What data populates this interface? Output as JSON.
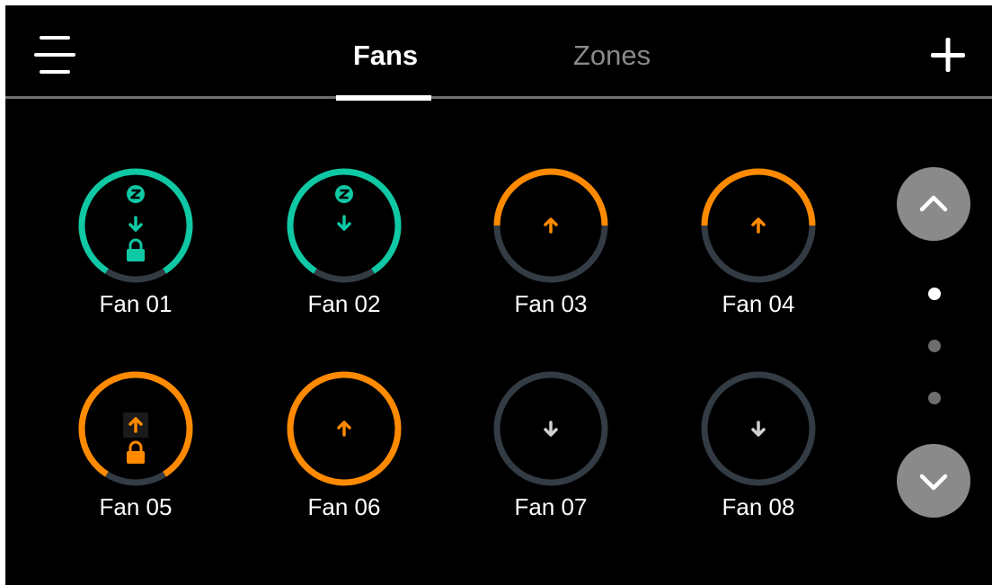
{
  "header": {
    "tabs": [
      {
        "label": "Fans",
        "active": true
      },
      {
        "label": "Zones",
        "active": false
      }
    ],
    "menu_icon": "menu-lines-icon",
    "add_icon": "plus-icon"
  },
  "colors": {
    "accent_teal": "#0fc8a4",
    "accent_orange": "#ff8a00",
    "ring_track": "#333b44",
    "arrow_grey": "#d0d0d0"
  },
  "fans": [
    {
      "name": "Fan 01",
      "mode": "sleep",
      "direction": "down",
      "locked": true,
      "level": 0.82
    },
    {
      "name": "Fan 02",
      "mode": "sleep",
      "direction": "down",
      "locked": false,
      "level": 0.82
    },
    {
      "name": "Fan 03",
      "mode": "active",
      "direction": "up",
      "locked": false,
      "level": 0.5
    },
    {
      "name": "Fan 04",
      "mode": "active",
      "direction": "up",
      "locked": false,
      "level": 0.5
    },
    {
      "name": "Fan 05",
      "mode": "active",
      "direction": "up",
      "locked": true,
      "level": 0.82
    },
    {
      "name": "Fan 06",
      "mode": "active",
      "direction": "up",
      "locked": false,
      "level": 1.0
    },
    {
      "name": "Fan 07",
      "mode": "off",
      "direction": "down",
      "locked": false,
      "level": 0
    },
    {
      "name": "Fan 08",
      "mode": "off",
      "direction": "down",
      "locked": false,
      "level": 0
    }
  ],
  "pagination": {
    "pages": 3,
    "current": 1
  },
  "scroll_icons": {
    "up": "chevron-up-icon",
    "down": "chevron-down-icon"
  }
}
